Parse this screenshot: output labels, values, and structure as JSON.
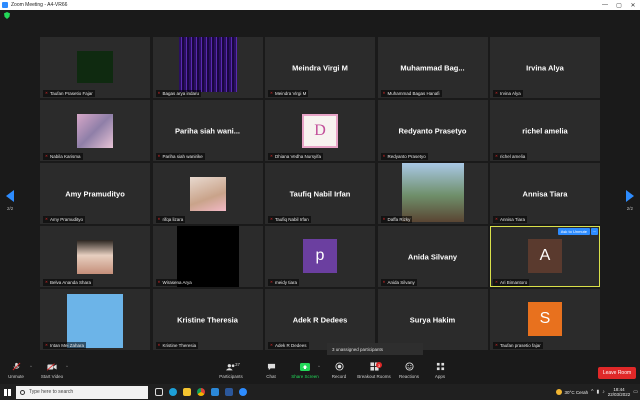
{
  "window": {
    "title": "Zoom Meeting - A4-VR66",
    "controls": [
      "—",
      "▢",
      "✕"
    ]
  },
  "pager": {
    "left": "2/2",
    "right": "2/2"
  },
  "tiles": [
    {
      "name": "Taufan Prasetio Fajar",
      "center_name": "",
      "kind": "video_dark"
    },
    {
      "name": "Bagas arya indaru",
      "center_name": "",
      "kind": "video_purple"
    },
    {
      "name": "Meindra Virgi M",
      "center_name": "Meindra Virgi M",
      "kind": "name"
    },
    {
      "name": "Muhammad Bagas Hanafi",
      "center_name": "Muhammad  Bag...",
      "kind": "name"
    },
    {
      "name": "Irvina Alya",
      "center_name": "Irvina Alya",
      "kind": "name"
    },
    {
      "name": "Nabila Karisma",
      "center_name": "",
      "kind": "photo_sky"
    },
    {
      "name": "Pariha siah wanirike",
      "center_name": "Pariha siah wani...",
      "kind": "name"
    },
    {
      "name": "Dhiana Vedha Nursyifa",
      "center_name": "",
      "kind": "photo_d",
      "letter": "D"
    },
    {
      "name": "Redyanto Prasetyo",
      "center_name": "Redyanto Prasetyo",
      "kind": "name"
    },
    {
      "name": "richel amelia",
      "center_name": "richel amelia",
      "kind": "name"
    },
    {
      "name": "Amy Pramudityo",
      "center_name": "Amy Pramudityo",
      "kind": "name"
    },
    {
      "name": "rifqa lizara",
      "center_name": "",
      "kind": "photo_girl"
    },
    {
      "name": "Taufiq Nabil Irfan",
      "center_name": "Taufiq Nabil Irfan",
      "kind": "name"
    },
    {
      "name": "Daffa Rizky",
      "center_name": "",
      "kind": "photo_group"
    },
    {
      "name": "Annisa Tiara",
      "center_name": "Annisa Tiara",
      "kind": "name"
    },
    {
      "name": "Belva Ananda Shara",
      "center_name": "",
      "kind": "photo_face"
    },
    {
      "name": "Wirasena Arya",
      "center_name": "",
      "kind": "video_black"
    },
    {
      "name": "meidy tiara",
      "center_name": "",
      "kind": "avatar",
      "letter": "p",
      "color": "#6b3fa0"
    },
    {
      "name": "Anida Silvany",
      "center_name": "Anida Silvany",
      "kind": "name"
    },
    {
      "name": "Ari Bimantoro",
      "center_name": "",
      "kind": "avatar_active",
      "letter": "A",
      "color": "#5a3a2e"
    },
    {
      "name": "Intan Mei Zahara",
      "center_name": "",
      "kind": "photo_blue"
    },
    {
      "name": "Kristine Theresia",
      "center_name": "Kristine Theresia",
      "kind": "name"
    },
    {
      "name": "Adek R Dedees",
      "center_name": "Adek R Dedees",
      "kind": "name"
    },
    {
      "name": "",
      "center_name": "Surya Hakim",
      "kind": "name_nocap"
    },
    {
      "name": "Taufan prasetio fajar",
      "center_name": "",
      "kind": "avatar",
      "letter": "S",
      "color": "#e8711e"
    }
  ],
  "active_tile": {
    "ask_unmute": "Ask to Unmute",
    "more": "···"
  },
  "tooltip": "3 unassigned participants",
  "toolbar": {
    "unmute": "Unmute",
    "start_video": "Start Video",
    "participants": "Participants",
    "participants_count": "37",
    "chat": "Chat",
    "share_screen": "Share Screen",
    "record": "Record",
    "breakout_rooms": "Breakout Rooms",
    "breakout_badge": "3",
    "reactions": "Reactions",
    "apps": "Apps",
    "leave": "Leave Room"
  },
  "taskbar": {
    "search_placeholder": "Type here to search",
    "weather": "30°C  Cerah",
    "time": "18:44",
    "date": "22/03/2022"
  },
  "colors": {
    "accent": "#2d8cff",
    "leave": "#e02828",
    "active_outline": "#d9e04a",
    "share_green": "#23d959"
  }
}
